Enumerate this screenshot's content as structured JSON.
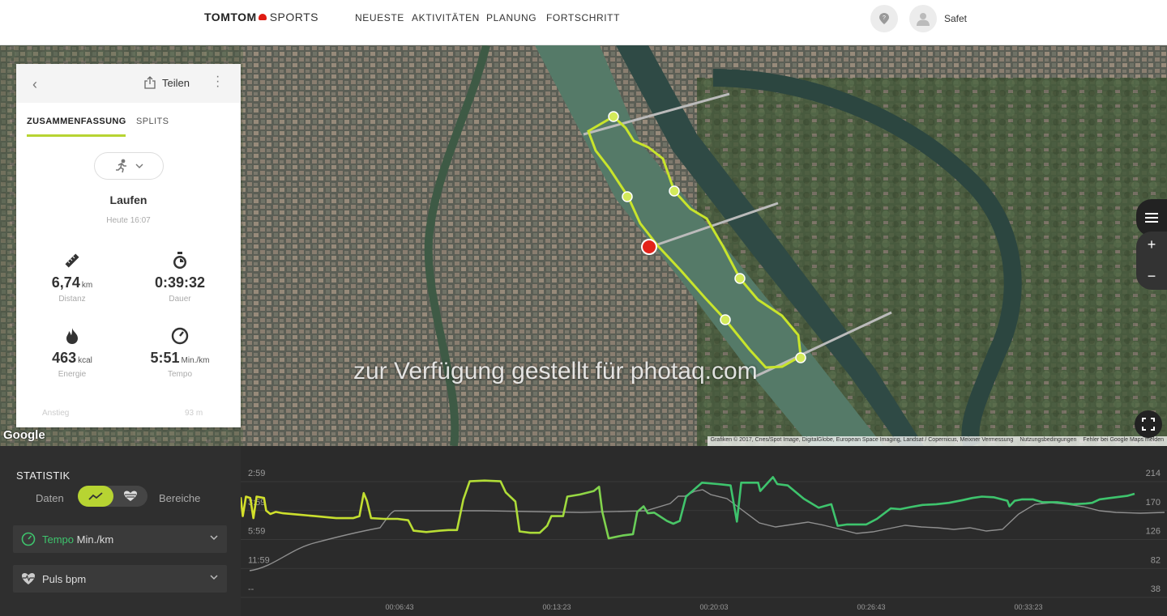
{
  "nav": {
    "logo_brand": "TOMTOM",
    "logo_product": "SPORTS",
    "items": [
      {
        "label": "NEUESTE"
      },
      {
        "label": "AKTIVITÄTEN"
      },
      {
        "label": "PLANUNG"
      },
      {
        "label": "FORTSCHRITT"
      }
    ],
    "username": "Safet"
  },
  "panel": {
    "share_label": "Teilen",
    "tabs": [
      {
        "label": "ZUSAMMENFASSUNG",
        "active": true
      },
      {
        "label": "SPLITS",
        "active": false
      }
    ],
    "activity_name": "Laufen",
    "activity_time": "Heute 16:07",
    "stats": [
      {
        "value": "6,74",
        "unit": "km",
        "label": "Distanz",
        "icon": "ruler-icon"
      },
      {
        "value": "0:39:32",
        "unit": "",
        "label": "Dauer",
        "icon": "stopwatch-icon"
      },
      {
        "value": "463",
        "unit": "kcal",
        "label": "Energie",
        "icon": "flame-icon"
      },
      {
        "value": "5:51",
        "unit": "Min./km",
        "label": "Tempo",
        "icon": "speedometer-icon"
      }
    ],
    "faded_left": "Anstieg",
    "faded_right": "93 m"
  },
  "map": {
    "watermark": "zur Verfügung gestellt für photaq.com",
    "google": "Google",
    "attribution": [
      "Grafiken © 2017, Cnes/Spot Image, DigitalGlobe, European Space Imaging, Landsat / Copernicus, Meixner Vermessung",
      "Nutzungsbedingungen",
      "Fehler bei Google Maps melden"
    ],
    "route_color": "#c8e42c"
  },
  "statistik": {
    "title": "STATISTIK",
    "toggle_left": "Daten",
    "toggle_right": "Bereiche",
    "metrics": [
      {
        "name": "Tempo",
        "unit": "Min./km",
        "accent": "#3ec46d"
      },
      {
        "name": "Puls",
        "unit": "bpm",
        "accent": "#cccccc"
      }
    ]
  },
  "chart_data": {
    "type": "line",
    "x_ticks": [
      "00:06:43",
      "00:13:23",
      "00:20:03",
      "00:26:43",
      "00:33:23"
    ],
    "x_range_minutes": [
      0,
      39.53
    ],
    "y_left_ticks": [
      "2:59",
      "3:59",
      "5:59",
      "11:59",
      "--"
    ],
    "y_right_ticks": [
      "214",
      "170",
      "126",
      "82",
      "38"
    ],
    "series": [
      {
        "name": "Tempo",
        "color_gradient": [
          "#d4e02a",
          "#3ec46d"
        ],
        "axis": "left",
        "points": [
          [
            0,
            131
          ],
          [
            0.2,
            104
          ],
          [
            0.5,
            132
          ],
          [
            0.9,
            130
          ],
          [
            1.2,
            101
          ],
          [
            1.5,
            132
          ],
          [
            2.2,
            130
          ],
          [
            2.4,
            112
          ],
          [
            2.8,
            107
          ],
          [
            3.3,
            110
          ],
          [
            4.0,
            108
          ],
          [
            5.5,
            106
          ],
          [
            7.0,
            104
          ],
          [
            9.0,
            101
          ],
          [
            10.6,
            101
          ],
          [
            11.2,
            104
          ],
          [
            11.6,
            137
          ],
          [
            11.9,
            126
          ],
          [
            12.3,
            101
          ],
          [
            13.5,
            100
          ],
          [
            14.8,
            100
          ],
          [
            15.8,
            98
          ],
          [
            16.3,
            83
          ],
          [
            17.5,
            81
          ],
          [
            18.8,
            83
          ],
          [
            19.6,
            84
          ],
          [
            20.4,
            84
          ],
          [
            21.0,
            128
          ],
          [
            21.6,
            154
          ],
          [
            23.0,
            155
          ],
          [
            24.5,
            154
          ],
          [
            25.0,
            138
          ],
          [
            25.9,
            125
          ],
          [
            26.3,
            82
          ],
          [
            27.3,
            80
          ],
          [
            28.2,
            80
          ],
          [
            28.9,
            90
          ],
          [
            29.3,
            104
          ],
          [
            30.4,
            104
          ],
          [
            30.8,
            132
          ],
          [
            32.0,
            135
          ],
          [
            33.3,
            140
          ],
          [
            33.8,
            146
          ],
          [
            34.1,
            110
          ],
          [
            34.7,
            72
          ],
          [
            36.0,
            76
          ],
          [
            37.0,
            78
          ],
          [
            37.4,
            110
          ],
          [
            38.0,
            118
          ],
          [
            38.4,
            108
          ],
          [
            39.0,
            109
          ],
          [
            40.2,
            97
          ],
          [
            40.8,
            93
          ],
          [
            41.4,
            97
          ],
          [
            42.0,
            132
          ],
          [
            43.5,
            152
          ],
          [
            45.0,
            150
          ],
          [
            46.2,
            148
          ],
          [
            46.8,
            96
          ],
          [
            47.2,
            152
          ],
          [
            48.8,
            152
          ],
          [
            49.0,
            140
          ],
          [
            50.2,
            160
          ],
          [
            50.6,
            150
          ],
          [
            51.6,
            148
          ],
          [
            53.1,
            129
          ],
          [
            54.5,
            116
          ],
          [
            55.7,
            121
          ],
          [
            56.3,
            90
          ],
          [
            57.2,
            92
          ],
          [
            58.0,
            92
          ],
          [
            59.0,
            92
          ],
          [
            60.0,
            100
          ],
          [
            61.3,
            115
          ],
          [
            62.2,
            114
          ],
          [
            63.2,
            117
          ],
          [
            64.3,
            120
          ],
          [
            65.6,
            121
          ],
          [
            66.8,
            123
          ],
          [
            68.1,
            127
          ],
          [
            69.0,
            130
          ],
          [
            69.9,
            132
          ],
          [
            71.0,
            131
          ],
          [
            72.3,
            126
          ],
          [
            72.5,
            118
          ],
          [
            73.0,
            126
          ],
          [
            73.7,
            128
          ],
          [
            74.7,
            128
          ],
          [
            74.7,
            128
          ],
          [
            75.6,
            124
          ],
          [
            77.0,
            124
          ],
          [
            78.5,
            121
          ],
          [
            79.7,
            122
          ],
          [
            80.3,
            123
          ],
          [
            81.0,
            128
          ],
          [
            82.0,
            130
          ],
          [
            83.6,
            133
          ],
          [
            84.3,
            136
          ]
        ]
      },
      {
        "name": "Puls",
        "color": "#9a9a9a",
        "axis": "right"
      }
    ]
  }
}
